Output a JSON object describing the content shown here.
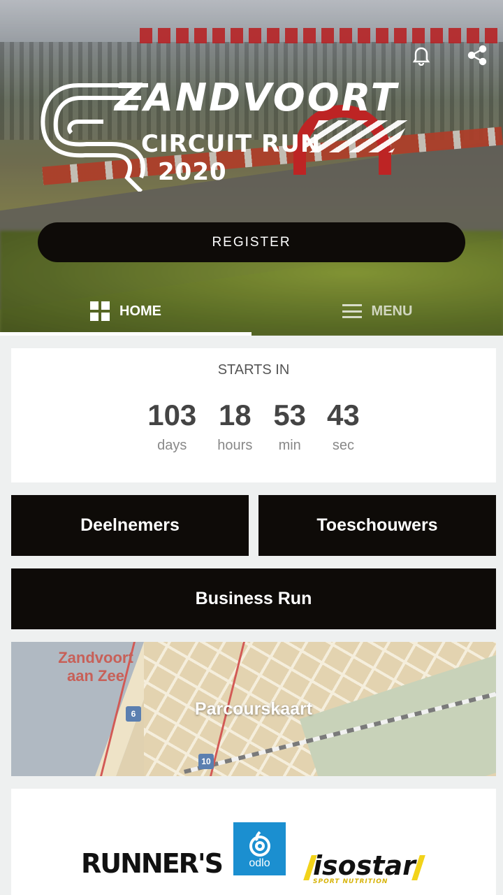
{
  "hero": {
    "logo_title": "ZANDVOORT",
    "logo_subtitle": "CIRCUIT RUN",
    "logo_year": "2020",
    "register_label": "REGISTER",
    "icons": [
      "bell-icon",
      "share-icon"
    ]
  },
  "tabs": [
    {
      "label": "HOME",
      "icon": "dashboard-icon",
      "active": true
    },
    {
      "label": "MENU",
      "icon": "hamburger-icon",
      "active": false
    }
  ],
  "countdown": {
    "label": "STARTS IN",
    "units": [
      {
        "value": "103",
        "unit": "days"
      },
      {
        "value": "18",
        "unit": "hours"
      },
      {
        "value": "53",
        "unit": "min"
      },
      {
        "value": "43",
        "unit": "sec"
      }
    ]
  },
  "buttons": {
    "deelnemers": "Deelnemers",
    "toeschouwers": "Toeschouwers",
    "business_run": "Business Run"
  },
  "map": {
    "label": "Parcourskaart",
    "town": "Zandvoort aan Zee"
  },
  "sponsors": {
    "runners": "RUNNER'S",
    "odlo": "odlo",
    "isostar": "isostar",
    "isostar_tag": "SPORT NUTRITION"
  },
  "colors": {
    "button_bg": "#0e0b08",
    "page_bg": "#eef0f0",
    "odlo_blue": "#1b8fd0",
    "isostar_yellow": "#f2d31a"
  }
}
